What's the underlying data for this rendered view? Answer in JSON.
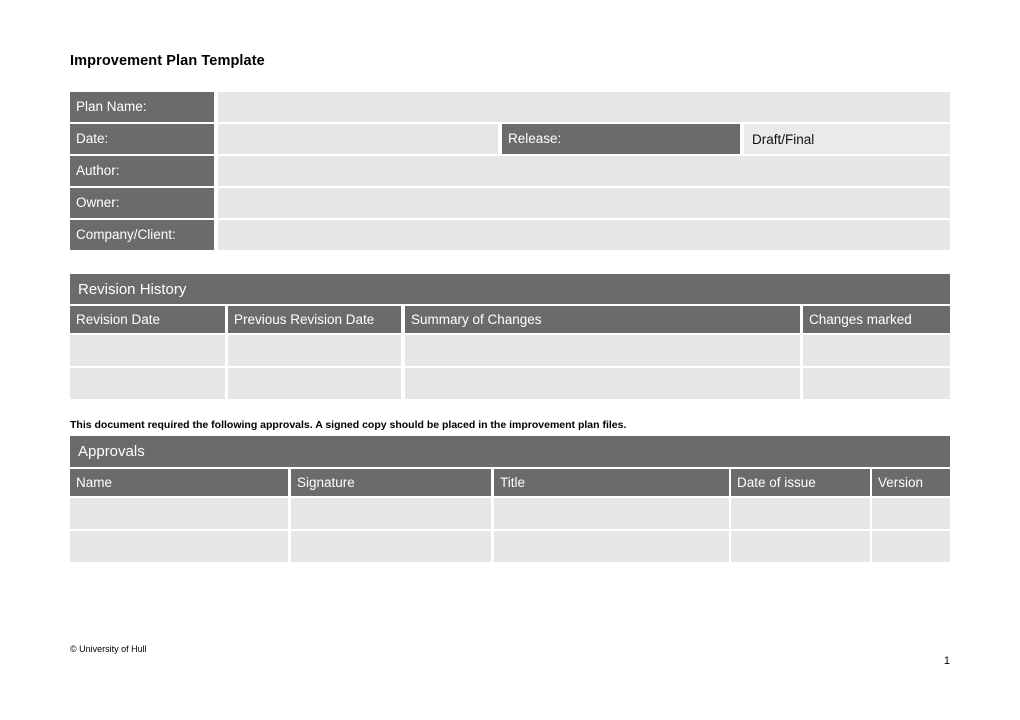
{
  "document": {
    "title": "Improvement Plan Template"
  },
  "plan_info": {
    "rows": [
      {
        "label": "Plan Name:",
        "value": "",
        "layout": "full"
      },
      {
        "label": "Date:",
        "value": "",
        "layout": "split",
        "second_label": "Release:",
        "second_value": "Draft/Final"
      },
      {
        "label": "Author:",
        "value": "",
        "layout": "full"
      },
      {
        "label": "Owner:",
        "value": "",
        "layout": "full"
      },
      {
        "label": "Company/Client:",
        "value": "",
        "layout": "full"
      }
    ]
  },
  "revision_history": {
    "section_title": "Revision History",
    "columns": [
      "Revision Date",
      "Previous Revision Date",
      "Summary of Changes",
      "Changes marked"
    ],
    "rows": [
      [
        "",
        "",
        "",
        ""
      ],
      [
        "",
        "",
        "",
        ""
      ]
    ]
  },
  "approvals": {
    "note": "This document required the following approvals. A signed copy should be placed in the improvement plan files.",
    "section_title": "Approvals",
    "columns": [
      "Name",
      "Signature",
      "Title",
      "Date of issue",
      "Version"
    ],
    "rows": [
      [
        "",
        "",
        "",
        "",
        ""
      ],
      [
        "",
        "",
        "",
        "",
        ""
      ]
    ]
  },
  "footer": {
    "copyright": "© University of Hull",
    "page_number": "1"
  },
  "colors": {
    "header_gray": "#6b6b6b",
    "cell_fill": "#e4e6e8",
    "value_fill": "#e8eaec",
    "page_background": "#ffffff",
    "text": "#000000"
  }
}
